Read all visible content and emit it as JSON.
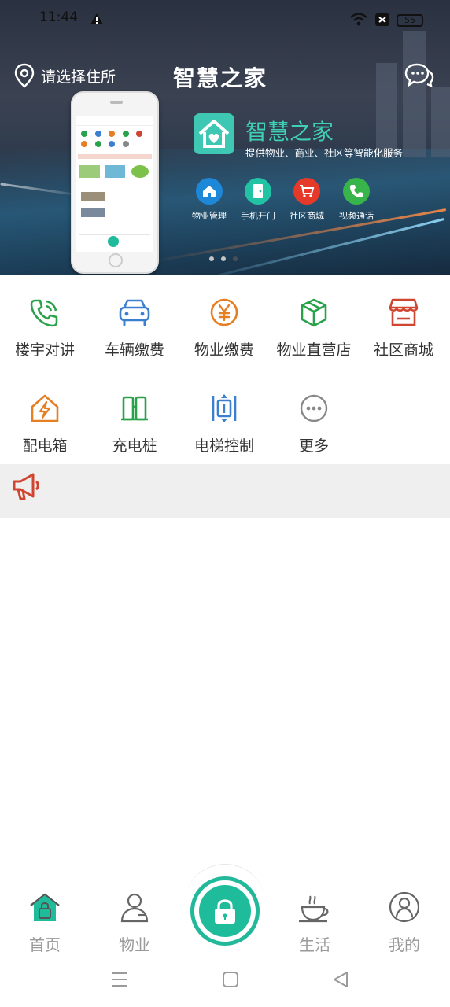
{
  "status_bar": {
    "time": "11:44",
    "battery": "55"
  },
  "header": {
    "location_label": "请选择住所",
    "app_title": "智慧之家"
  },
  "banner": {
    "brand_name": "智慧之家",
    "brand_tagline": "提供物业、商业、社区等智能化服务",
    "features": [
      {
        "label": "物业管理",
        "icon": "home-icon",
        "color": "#1e88d8"
      },
      {
        "label": "手机开门",
        "icon": "door-icon",
        "color": "#22c3a4"
      },
      {
        "label": "社区商城",
        "icon": "cart-icon",
        "color": "#e53a2a"
      },
      {
        "label": "视频通话",
        "icon": "phone-icon",
        "color": "#38b54a"
      }
    ],
    "page_count": 3,
    "active_page": 3
  },
  "services": [
    {
      "label": "楼宇对讲",
      "icon": "intercom-phone-icon",
      "color": "#2aa24b"
    },
    {
      "label": "车辆缴费",
      "icon": "car-icon",
      "color": "#3b7fd0"
    },
    {
      "label": "物业缴费",
      "icon": "yen-coin-icon",
      "color": "#e67e22"
    },
    {
      "label": "物业直营店",
      "icon": "box-icon",
      "color": "#2aa24b"
    },
    {
      "label": "社区商城",
      "icon": "shop-icon",
      "color": "#d0452f"
    },
    {
      "label": "配电箱",
      "icon": "power-box-icon",
      "color": "#e67e22"
    },
    {
      "label": "充电桩",
      "icon": "charging-pile-icon",
      "color": "#2aa24b"
    },
    {
      "label": "电梯控制",
      "icon": "elevator-icon",
      "color": "#3b7fd0"
    },
    {
      "label": "更多",
      "icon": "more-icon",
      "color": "#888888"
    }
  ],
  "notice": {
    "icon": "megaphone-icon",
    "color": "#d0452f"
  },
  "tabbar": {
    "tabs": [
      {
        "label": "首页",
        "icon": "home-lock-icon"
      },
      {
        "label": "物业",
        "icon": "person-icon"
      },
      {
        "label": "生活",
        "icon": "coffee-icon"
      },
      {
        "label": "我的",
        "icon": "profile-icon"
      }
    ],
    "center_icon": "lock-icon",
    "accent": "#1fbc9c"
  }
}
